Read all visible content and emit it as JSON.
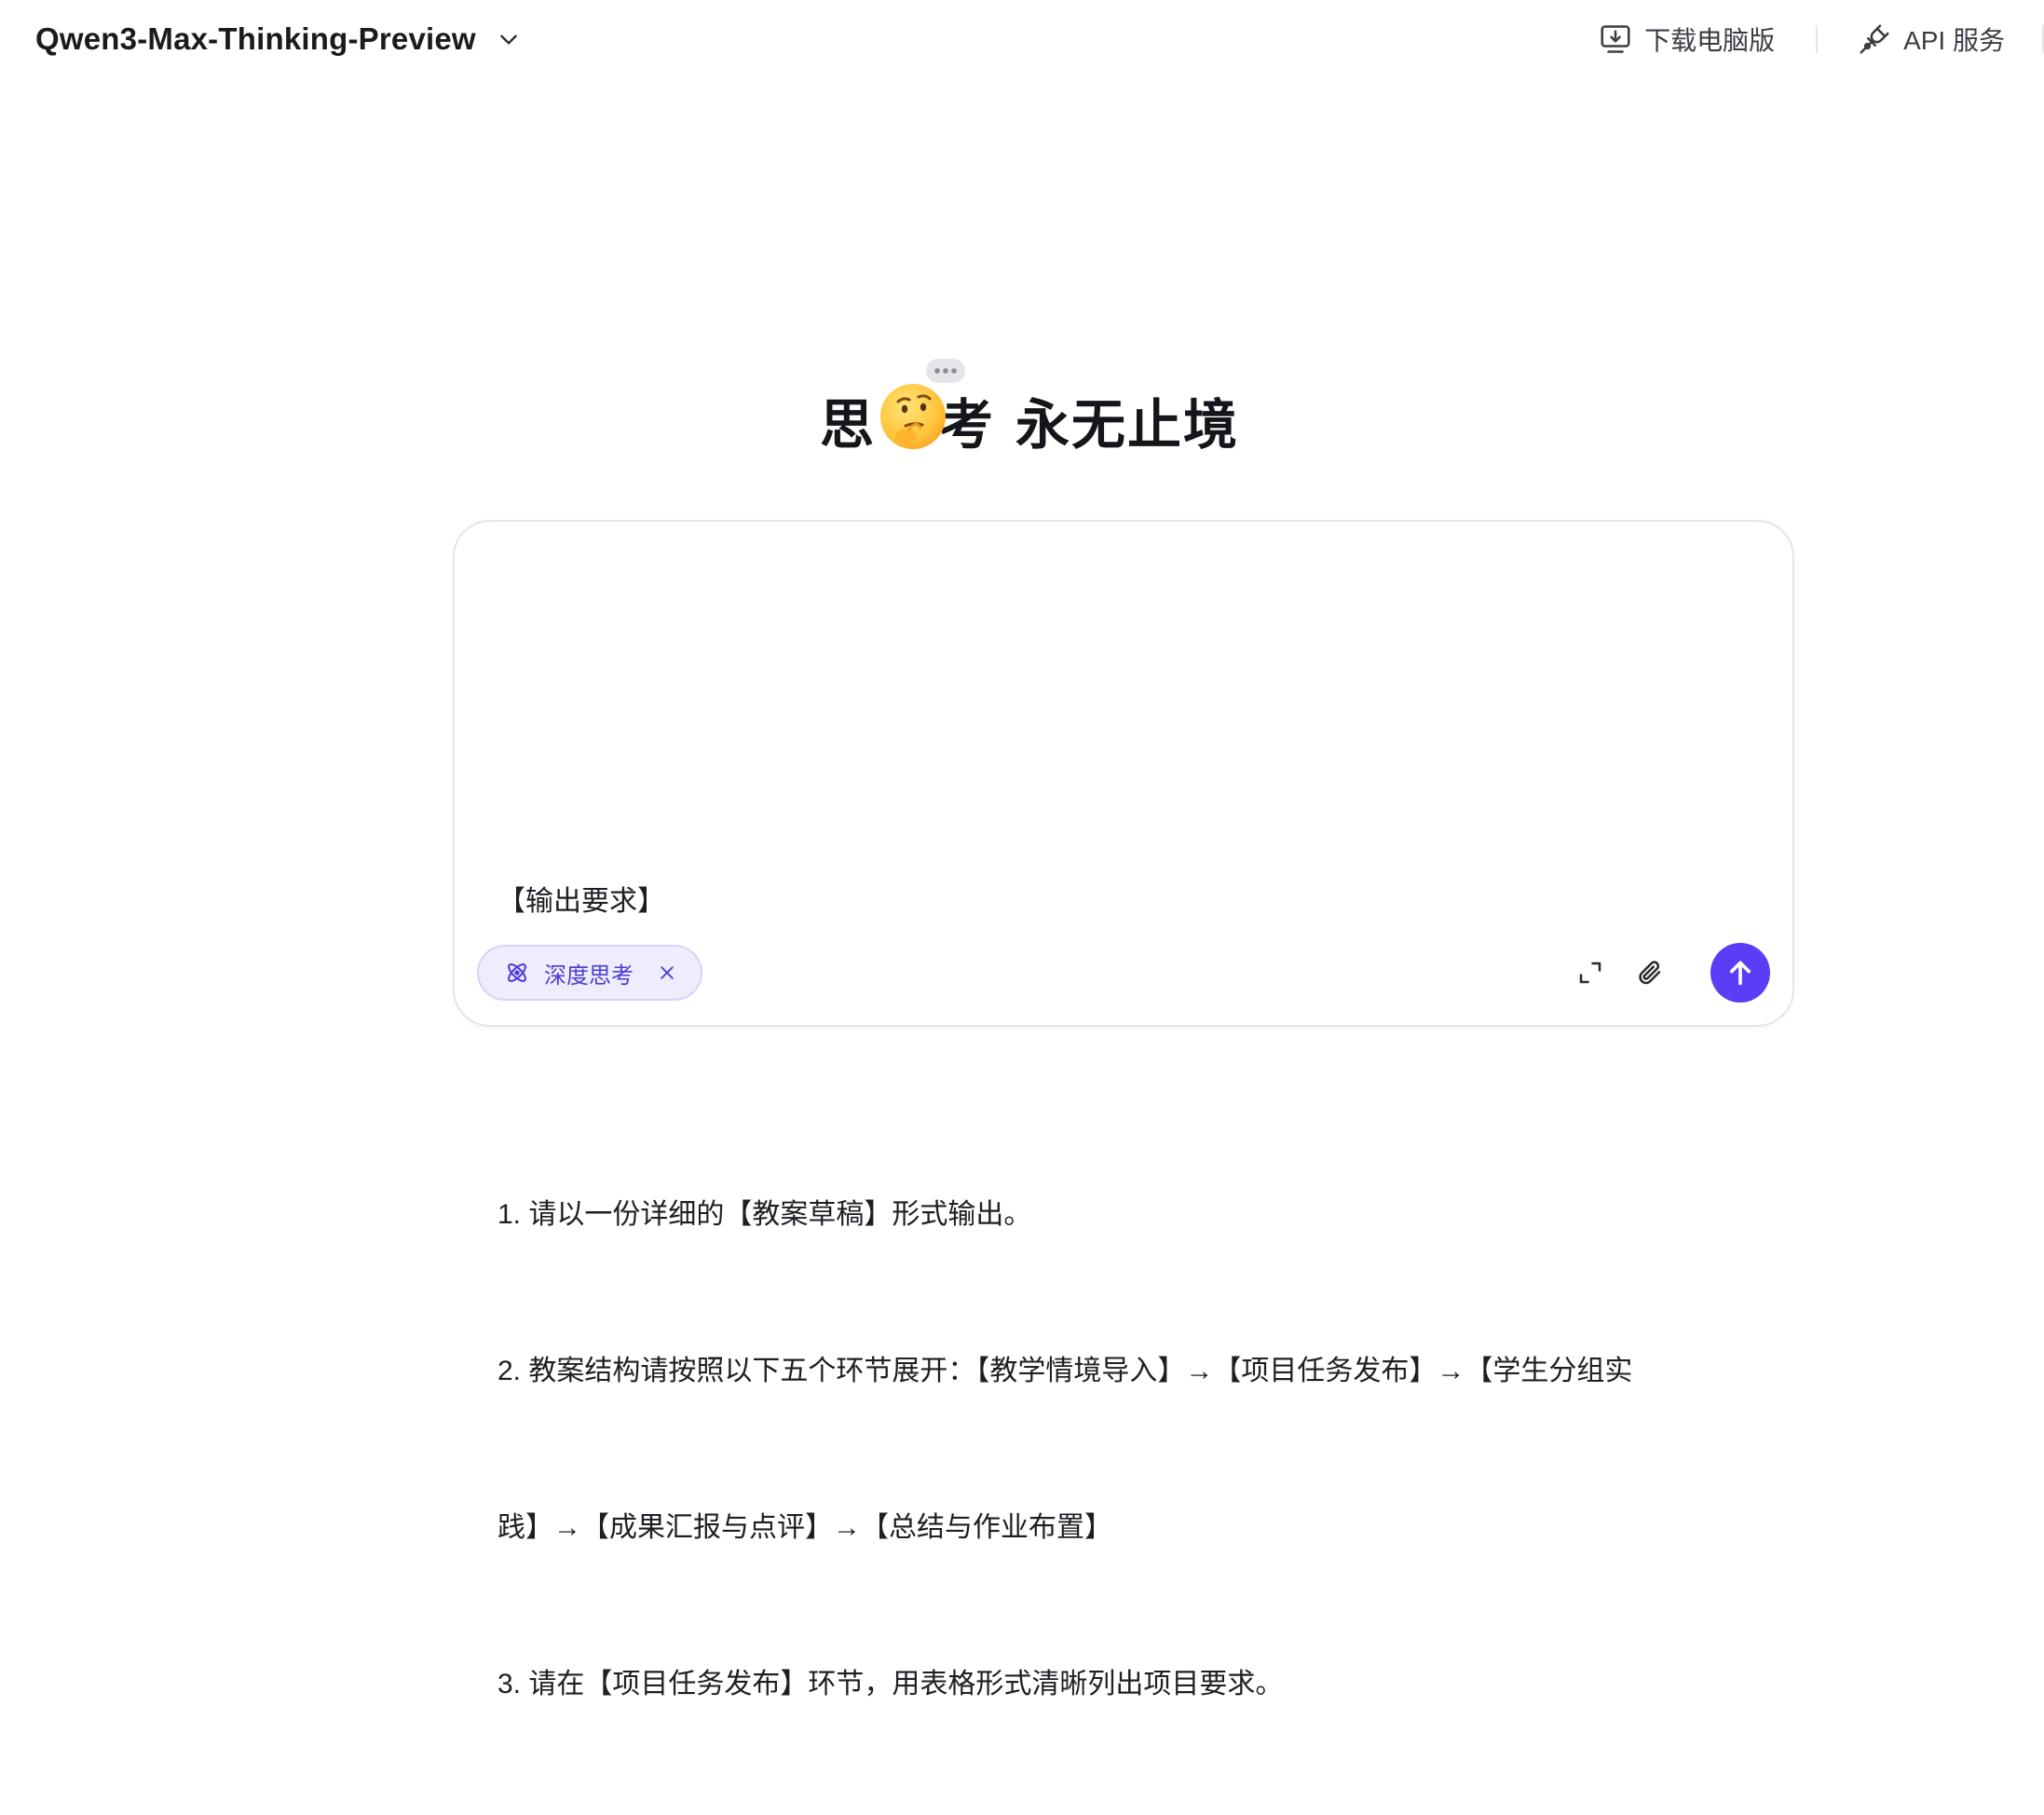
{
  "header": {
    "model_name": "Qwen3-Max-Thinking-Preview",
    "download_label": "下载电脑版",
    "api_label": "API 服务"
  },
  "hero": {
    "part1": "思",
    "part2": "考",
    "part3": "永无止境",
    "emoji_icon": "thinking-face-emoji"
  },
  "input": {
    "prompt_lines": [
      "",
      "【输出要求】",
      "",
      "1. 请以一份详细的【教案草稿】形式输出。",
      "2. 教案结构请按照以下五个环节展开：【教学情境导入】→【项目任务发布】→【学生分组实",
      "践】→【成果汇报与点评】→【总结与作业布置】",
      "3. 请在【项目任务发布】环节，用表格形式清晰列出项目要求。"
    ],
    "mode_chip_label": "深度思考"
  },
  "colors": {
    "accent": "#5a3df5",
    "chip_bg": "#eeecfd",
    "chip_text": "#4b3fd6"
  },
  "icons": {
    "model_dropdown": "chevron-down-icon",
    "download": "monitor-download-icon",
    "api": "plug-icon",
    "mode": "atom-icon",
    "mode_close": "close-icon",
    "expand": "expand-icon",
    "attach": "paperclip-icon",
    "send": "arrow-up-icon"
  }
}
